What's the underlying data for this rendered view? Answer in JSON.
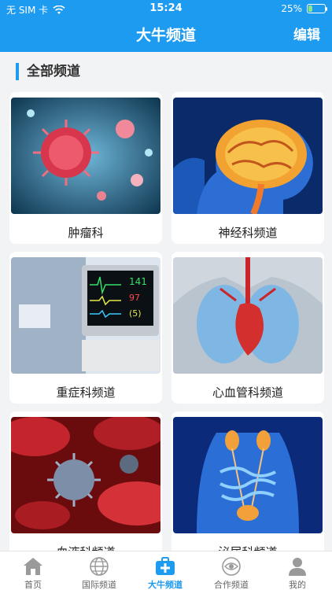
{
  "status_bar": {
    "carrier": "无 SIM 卡",
    "time": "15:24",
    "battery": "25%",
    "battery_level": 0.25
  },
  "header": {
    "title": "大牛频道",
    "edit_label": "编辑"
  },
  "section": {
    "title": "全部频道"
  },
  "channels": [
    {
      "label": "肿瘤科"
    },
    {
      "label": "神经科频道"
    },
    {
      "label": "重症科频道"
    },
    {
      "label": "心血管科频道"
    },
    {
      "label": "血液科频道"
    },
    {
      "label": "泌尿科频道"
    }
  ],
  "tabbar": {
    "tabs": [
      {
        "label": "首页",
        "icon": "home-icon"
      },
      {
        "label": "国际频道",
        "icon": "globe-icon"
      },
      {
        "label": "大牛频道",
        "icon": "medical-kit-icon",
        "active": true
      },
      {
        "label": "合作频道",
        "icon": "eye-icon"
      },
      {
        "label": "我的",
        "icon": "person-icon"
      }
    ]
  },
  "colors": {
    "primary": "#1d9bf0",
    "background": "#f2f3f5"
  }
}
